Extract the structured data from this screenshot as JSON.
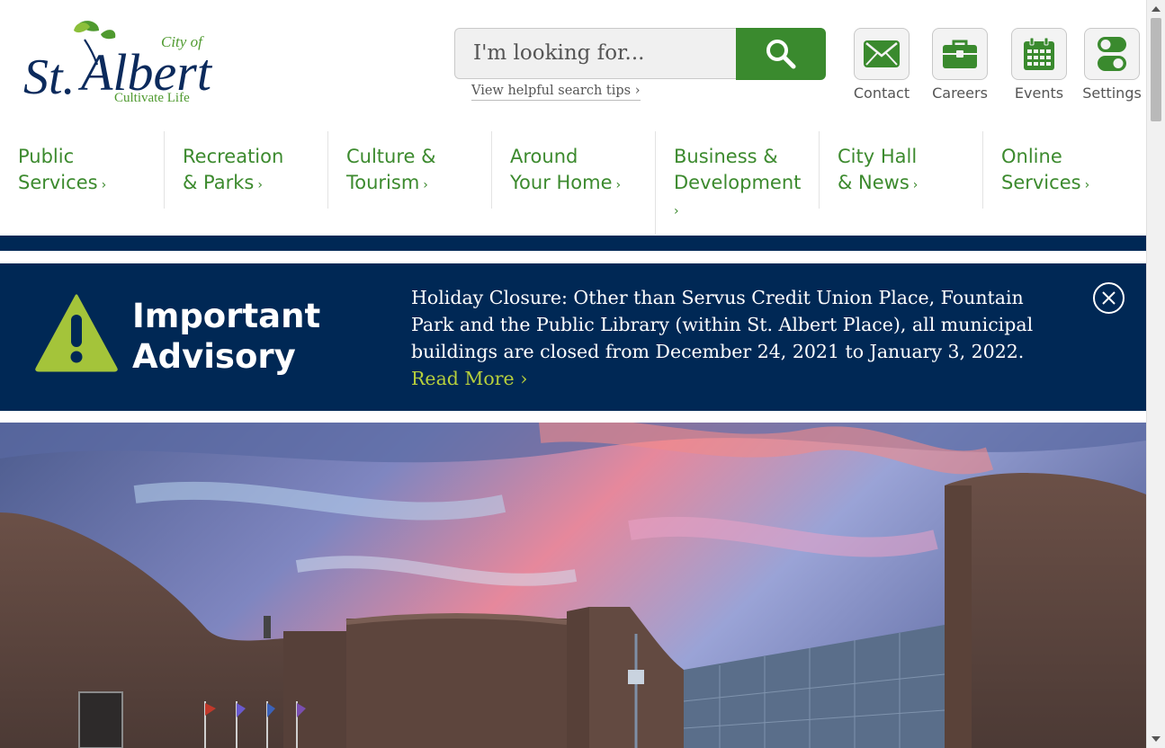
{
  "logo": {
    "city_of": "City of",
    "name_st": "St.",
    "name_albert": "Albert",
    "tagline": "Cultivate Life"
  },
  "search": {
    "placeholder": "I'm looking for...",
    "tips_label": "View helpful search tips ›"
  },
  "utility": [
    {
      "label": "Contact",
      "icon": "envelope-icon"
    },
    {
      "label": "Careers",
      "icon": "briefcase-icon"
    },
    {
      "label": "Events",
      "icon": "calendar-icon"
    },
    {
      "label": "Settings",
      "icon": "toggle-icon"
    }
  ],
  "nav": [
    {
      "line1": "Public",
      "line2": "Services",
      "arrow": "›"
    },
    {
      "line1": "Recreation",
      "line2": "& Parks",
      "arrow": "›"
    },
    {
      "line1": "Culture &",
      "line2": "Tourism",
      "arrow": "›"
    },
    {
      "line1": "Around",
      "line2": "Your Home",
      "arrow": "›"
    },
    {
      "line1": "Business &",
      "line2": "Development",
      "arrow": "›"
    },
    {
      "line1": "City Hall",
      "line2": "& News",
      "arrow": "›"
    },
    {
      "line1": "Online",
      "line2": "Services",
      "arrow": "›"
    }
  ],
  "advisory": {
    "title_line1": "Important",
    "title_line2": "Advisory",
    "text": "Holiday Closure: Other than Servus Credit Union Place, Fountain Park and the Public Library (within St. Albert Place), all municipal buildings are closed from December 24, 2021 to January 3, 2022.",
    "link": "Read More ›"
  },
  "colors": {
    "brand_green": "#3a8a2e",
    "navy": "#002855",
    "lime": "#b6cf3c"
  }
}
